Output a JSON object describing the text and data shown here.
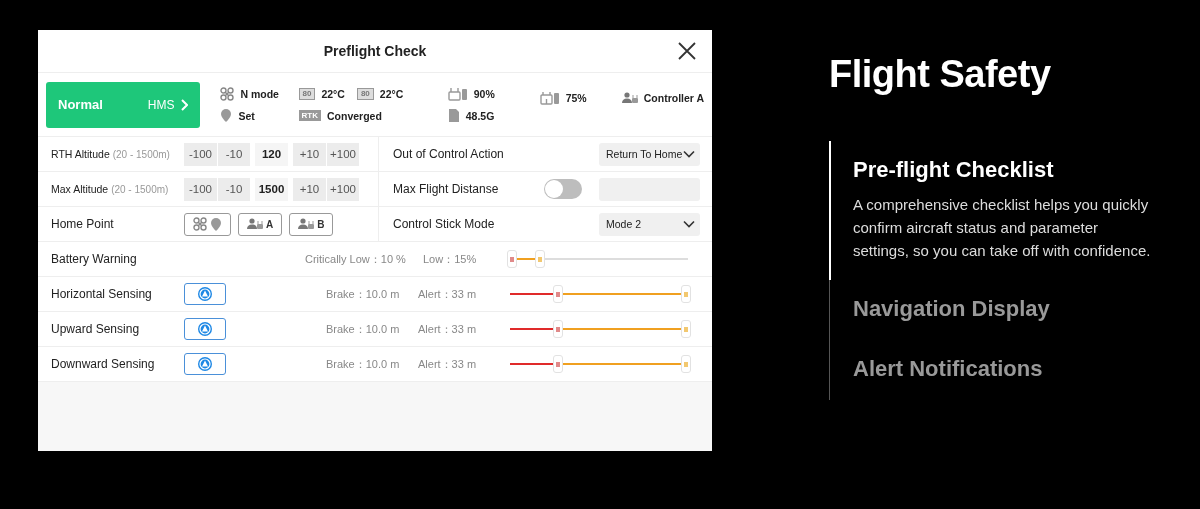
{
  "dialog": {
    "title": "Preflight Check",
    "status": {
      "mode": "Normal",
      "hms": "HMS",
      "flight_mode": "N mode",
      "home": "Set",
      "temps": [
        {
          "battery": "80",
          "temp": "22°C"
        },
        {
          "battery": "80",
          "temp": "22°C"
        }
      ],
      "rtk": "RTK",
      "rtk_status": "Converged",
      "remote_battery": "90%",
      "storage": "48.5G",
      "aircraft_battery": "75%",
      "controller": "Controller A"
    },
    "altitude_rows": [
      {
        "label": "RTH Altitude",
        "range": "(20 - 1500m)",
        "minus": [
          "-100",
          "-10"
        ],
        "value": "120",
        "plus": [
          "+10",
          "+100"
        ]
      },
      {
        "label": "Max Altitude",
        "range": "(20 - 1500m)",
        "minus": [
          "-100",
          "-10"
        ],
        "value": "1500",
        "plus": [
          "+10",
          "+100"
        ]
      }
    ],
    "home_point": {
      "label": "Home Point",
      "buttons": [
        {
          "kind": "aircraft"
        },
        {
          "kind": "controller",
          "text": "A"
        },
        {
          "kind": "controller",
          "text": "B"
        }
      ]
    },
    "right_settings": [
      {
        "kind": "dropdown",
        "label": "Out of Control Action",
        "value": "Return To Home"
      },
      {
        "kind": "toggle",
        "label": "Max Flight Distanse",
        "on": false
      },
      {
        "kind": "dropdown",
        "label": "Control Stick Mode",
        "value": "Mode 2"
      }
    ],
    "battery_warning": {
      "label": "Battery Warning",
      "critical": "Critically Low：10 %",
      "low": "Low：15%"
    },
    "sensing": [
      {
        "label": "Horizontal Sensing",
        "brake": "Brake：10.0 m",
        "alert": "Alert：33 m"
      },
      {
        "label": "Upward Sensing",
        "brake": "Brake：10.0 m",
        "alert": "Alert：33 m"
      },
      {
        "label": "Downward Sensing",
        "brake": "Brake：10.0 m",
        "alert": "Alert：33 m"
      }
    ]
  },
  "feature": {
    "title": "Flight Safety",
    "sections": [
      {
        "title": "Pre-flight Checklist",
        "selected": true,
        "description": "A comprehensive checklist helps you quickly confirm aircraft status and parameter settings, so you can take off with confidence."
      },
      {
        "title": "Navigation Display",
        "selected": false
      },
      {
        "title": "Alert Notifications",
        "selected": false
      }
    ]
  }
}
